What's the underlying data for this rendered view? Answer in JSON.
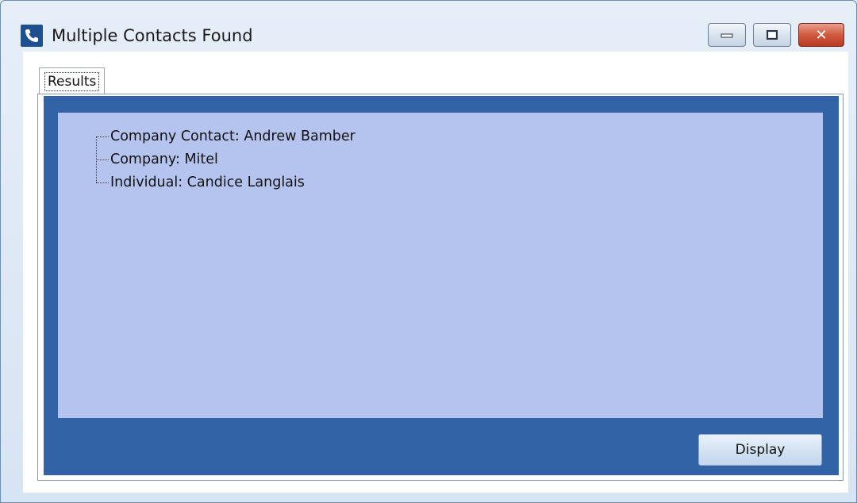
{
  "window": {
    "title": "Multiple Contacts Found",
    "app_icon": "phone-icon",
    "controls": {
      "minimize": "minimize-icon",
      "maximize": "maximize-icon",
      "close": "close-icon"
    }
  },
  "tabs": [
    {
      "label": "Results",
      "active": true
    }
  ],
  "results": {
    "items": [
      {
        "label": "Company Contact: Andrew Bamber"
      },
      {
        "label": "Company: Mitel"
      },
      {
        "label": "Individual: Candice Langlais"
      }
    ]
  },
  "buttons": {
    "display_label": "Display"
  },
  "colors": {
    "frame_blue": "#3263a6",
    "tree_background": "#b4c4ee",
    "close_red": "#c94a30"
  }
}
